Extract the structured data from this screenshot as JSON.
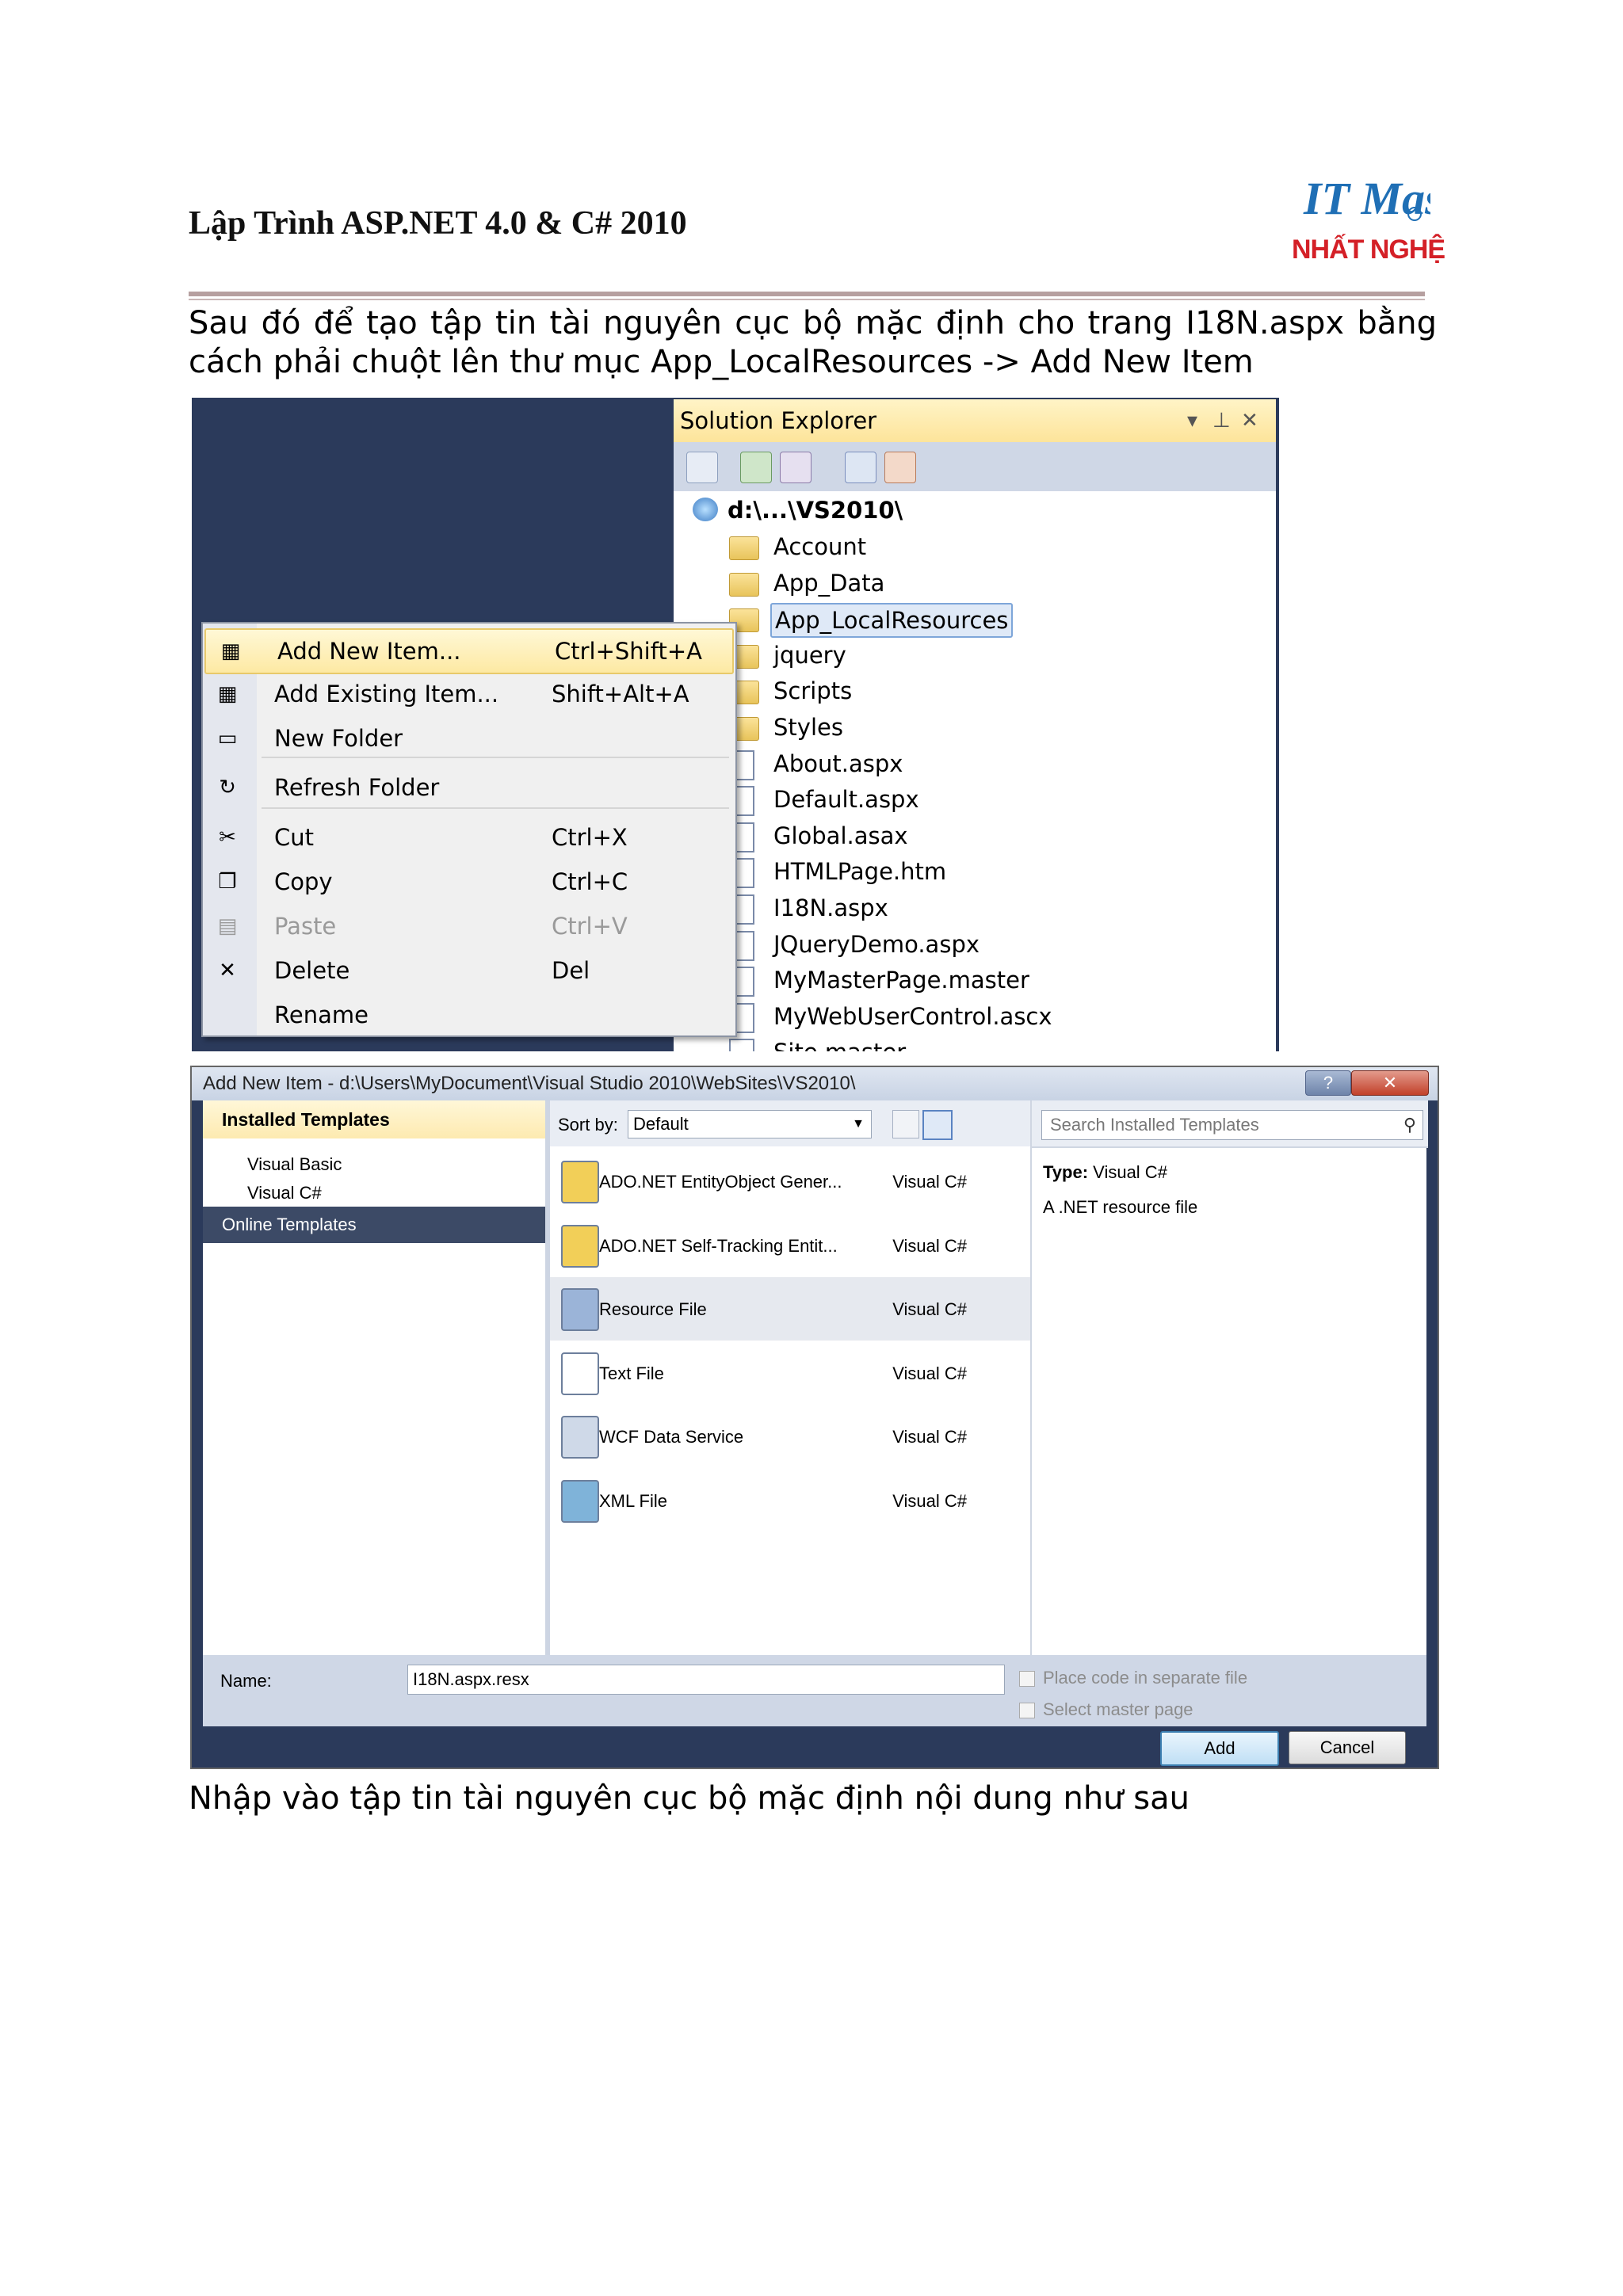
{
  "header": {
    "title": "Lập Trình ASP.NET 4.0 & C# 2010",
    "logo_text": "NHẤT NGHỆ",
    "logo_mark": "IT Master"
  },
  "intro": "Sau đó để tạo tập tin tài nguyên cục bộ mặc định cho trang I18N.aspx bằng cách phải chuột lên thư mục App_LocalResources -> Add New Item",
  "outro": "Nhập vào tập tin tài nguyên cục bộ mặc định nội dung như sau",
  "solution_explorer": {
    "title": "Solution Explorer",
    "root": "d:\\...\\VS2010\\",
    "items": [
      {
        "label": "Account",
        "icon": "folder-icon"
      },
      {
        "label": "App_Data",
        "icon": "folder-icon"
      },
      {
        "label": "App_LocalResources",
        "icon": "folder-icon",
        "selected": true
      },
      {
        "label": "jquery",
        "icon": "folder-icon"
      },
      {
        "label": "Scripts",
        "icon": "folder-icon"
      },
      {
        "label": "Styles",
        "icon": "folder-icon"
      },
      {
        "label": "About.aspx",
        "icon": "file-icon"
      },
      {
        "label": "Default.aspx",
        "icon": "file-icon"
      },
      {
        "label": "Global.asax",
        "icon": "file-icon"
      },
      {
        "label": "HTMLPage.htm",
        "icon": "file-icon"
      },
      {
        "label": "I18N.aspx",
        "icon": "file-icon"
      },
      {
        "label": "JQueryDemo.aspx",
        "icon": "file-icon"
      },
      {
        "label": "MyMasterPage.master",
        "icon": "file-icon"
      },
      {
        "label": "MyWebUserControl.ascx",
        "icon": "file-icon"
      },
      {
        "label": "Site.master",
        "icon": "file-icon"
      }
    ]
  },
  "context_menu": [
    {
      "label": "Add New Item...",
      "shortcut": "Ctrl+Shift+A",
      "icon": "add-item-icon",
      "highlight": true
    },
    {
      "label": "Add Existing Item...",
      "shortcut": "Shift+Alt+A",
      "icon": "add-existing-icon"
    },
    {
      "label": "New Folder",
      "shortcut": "",
      "icon": "folder-icon"
    },
    {
      "label": "Refresh Folder",
      "shortcut": "",
      "icon": "refresh-icon"
    },
    {
      "label": "Cut",
      "shortcut": "Ctrl+X",
      "icon": "scissors-icon"
    },
    {
      "label": "Copy",
      "shortcut": "Ctrl+C",
      "icon": "copy-icon"
    },
    {
      "label": "Paste",
      "shortcut": "Ctrl+V",
      "icon": "paste-icon",
      "disabled": true
    },
    {
      "label": "Delete",
      "shortcut": "Del",
      "icon": "delete-icon"
    },
    {
      "label": "Rename",
      "shortcut": "",
      "icon": ""
    }
  ],
  "dialog": {
    "title": "Add New Item - d:\\Users\\MyDocument\\Visual Studio 2010\\WebSites\\VS2010\\",
    "installed_templates": "Installed Templates",
    "languages": [
      "Visual Basic",
      "Visual C#"
    ],
    "online_templates": "Online Templates",
    "sort_label": "Sort by:",
    "sort_value": "Default",
    "search_placeholder": "Search Installed Templates",
    "templates": [
      {
        "name": "ADO.NET EntityObject Gener...",
        "lang": "Visual C#"
      },
      {
        "name": "ADO.NET Self-Tracking Entit...",
        "lang": "Visual C#"
      },
      {
        "name": "Resource File",
        "lang": "Visual C#",
        "selected": true
      },
      {
        "name": "Text File",
        "lang": "Visual C#"
      },
      {
        "name": "WCF Data Service",
        "lang": "Visual C#"
      },
      {
        "name": "XML File",
        "lang": "Visual C#"
      }
    ],
    "type_label": "Type:",
    "type_value": "Visual C#",
    "description": "A .NET resource file",
    "name_label": "Name:",
    "name_value": "I18N.aspx.resx",
    "place_code": "Place code in separate file",
    "select_master": "Select master page",
    "add_button": "Add",
    "cancel_button": "Cancel"
  }
}
